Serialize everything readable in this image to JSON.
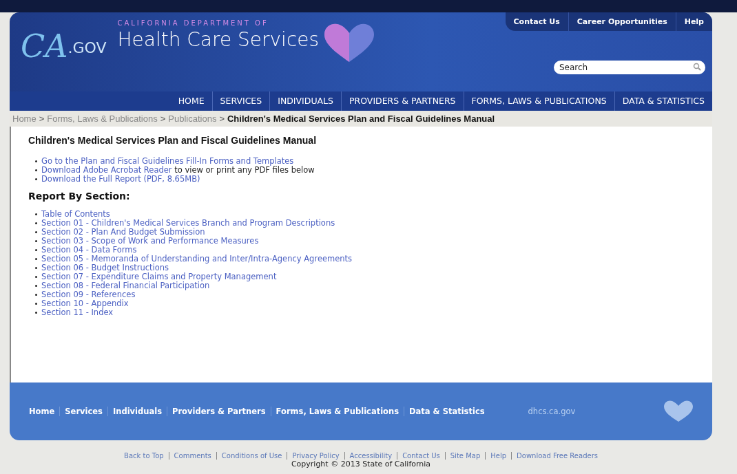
{
  "header": {
    "logo_ca": "CA",
    "logo_gov": ".GOV",
    "department": "CALIFORNIA DEPARTMENT OF",
    "title": "Health Care Services",
    "utility_links": [
      "Contact Us",
      "Career Opportunities",
      "Help"
    ],
    "search": {
      "placeholder": "Search"
    }
  },
  "nav": [
    "HOME",
    "SERVICES",
    "INDIVIDUALS",
    "PROVIDERS & PARTNERS",
    "FORMS, LAWS & PUBLICATIONS",
    "DATA & STATISTICS"
  ],
  "breadcrumb": {
    "separator": ">",
    "links": [
      "Home",
      "Forms, Laws & Publications",
      "Publications"
    ],
    "current": "Children's Medical Services Plan and Fiscal Guidelines Manual"
  },
  "content": {
    "title": "Children's Medical Services Plan and Fiscal Guidelines Manual",
    "intro": [
      {
        "link": "Go to the Plan and Fiscal Guidelines Fill-In Forms and Templates"
      },
      {
        "link": "Download Adobe Acrobat Reader",
        "text": " to view or print any PDF files below"
      },
      {
        "link": "Download the Full Report (PDF, 8.65MB)"
      }
    ],
    "section_heading": "Report By Section:",
    "sections": [
      "Table of Contents",
      "Section 01 - Children's Medical Services Branch and Program Descriptions",
      "Section 02 - Plan And Budget Submission",
      "Section 03 - Scope of Work and Performance Measures",
      "Section 04 - Data Forms",
      "Section 05 - Memoranda of Understanding and Inter/Intra-Agency Agreements",
      "Section 06 - Budget Instructions",
      "Section 07 - Expenditure Claims and Property Management",
      "Section 08 - Federal Financial Participation",
      "Section 09 - References",
      "Section 10 - Appendix",
      "Section 11 - Index"
    ]
  },
  "footer": {
    "links": [
      "Home",
      "Services",
      "Individuals",
      "Providers & Partners",
      "Forms, Laws & Publications",
      "Data & Statistics"
    ],
    "domain": "dhcs.ca.gov"
  },
  "bottom": {
    "links": [
      "Back to Top",
      "Comments",
      "Conditions of Use",
      "Privacy Policy",
      "Accessibility",
      "Contact Us",
      "Site Map",
      "Help",
      "Download Free Readers"
    ],
    "copyright": "Copyright © 2013 State of California"
  }
}
